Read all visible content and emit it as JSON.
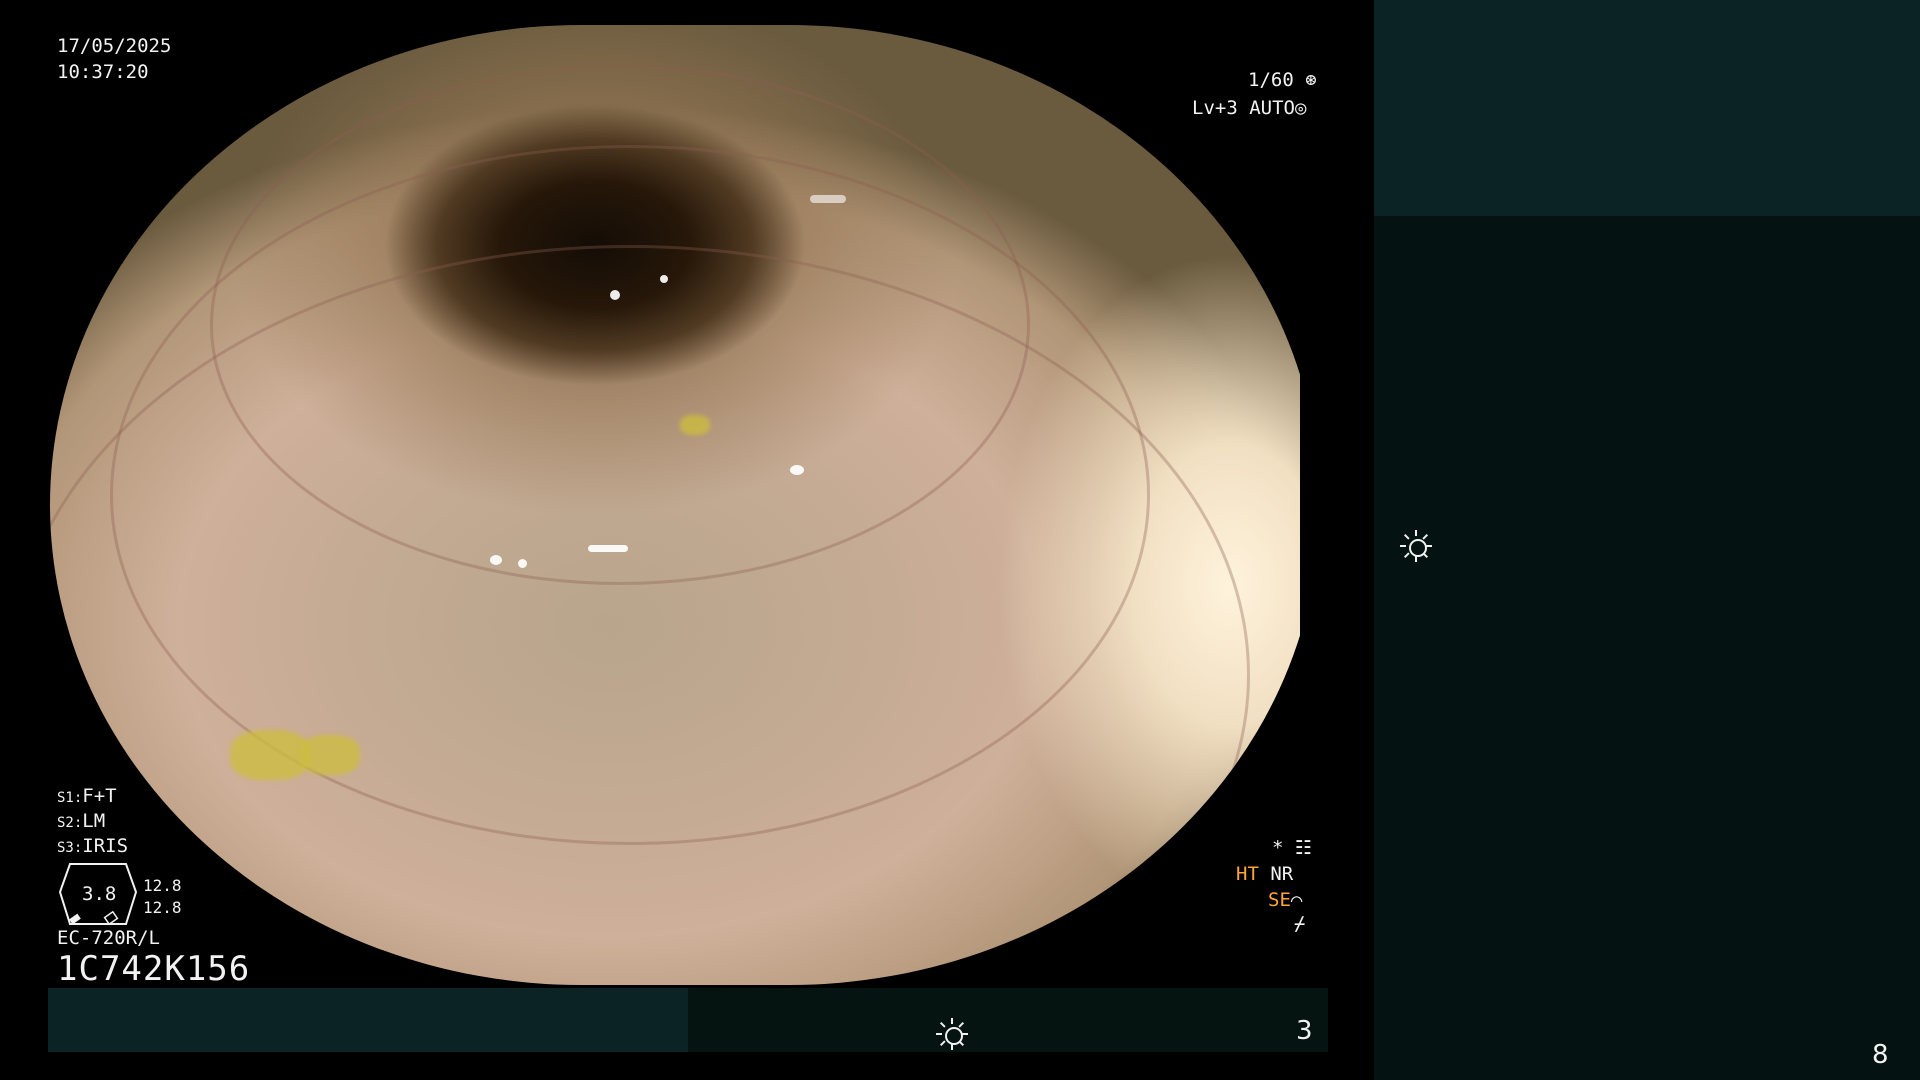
{
  "header": {
    "date": "17/05/2025",
    "time": "10:37:20"
  },
  "top_right": {
    "shutter": "1/60",
    "shutter_icon": "aperture-icon",
    "level": "Lv+3",
    "mode": "AUTO",
    "mode_icon": "iris-icon"
  },
  "left_info": {
    "s1_label": "S1:",
    "s1_value": "F+T",
    "s2_label": "S2:",
    "s2_value": "LM",
    "s3_label": "S3:",
    "s3_value": "IRIS",
    "gauge_value": "3.8",
    "gauge_top": "12.8",
    "gauge_bottom": "12.8",
    "scope_model": "EC-720R/L",
    "serial": "1C742K156"
  },
  "right_info": {
    "star": "*",
    "settings_icon": "filter-settings-icon",
    "ht": "HT",
    "nr": "NR",
    "se": "SE",
    "se_icon": "structure-enhance-icon",
    "enhance_icon": "edge-icon"
  },
  "bottom_bar": {
    "brightness_icon": "brightness-icon",
    "counter": "3"
  },
  "side_panel": {
    "brightness_icon": "brightness-icon",
    "counter": "8"
  },
  "colors": {
    "overlay_text": "#f2f2f2",
    "accent_orange": "#ffa63a",
    "panel_teal_dark": "#041311",
    "panel_teal_light": "#0c2326"
  }
}
